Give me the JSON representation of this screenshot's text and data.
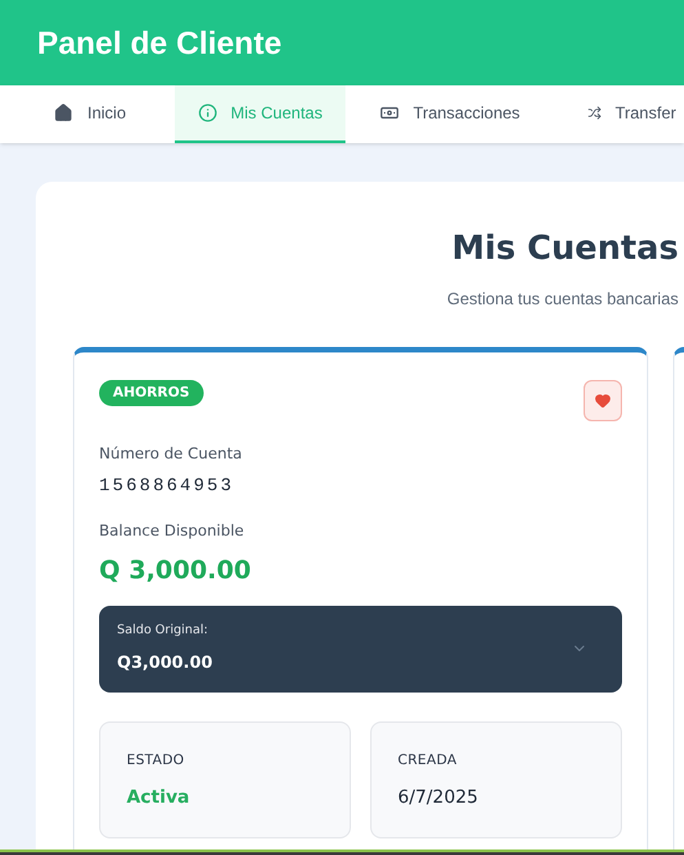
{
  "header": {
    "title": "Panel de Cliente"
  },
  "tabs": [
    {
      "label": "Inicio",
      "selected": false
    },
    {
      "label": "Mis Cuentas",
      "selected": true
    },
    {
      "label": "Transacciones",
      "selected": false
    },
    {
      "label": "Transfer",
      "selected": false
    }
  ],
  "page": {
    "title": "Mis Cuentas",
    "subtitle": "Gestiona tus cuentas bancarias"
  },
  "accounts": [
    {
      "type": "AHORROS",
      "favorite": true,
      "number_label": "Número de Cuenta",
      "number": "1568864953",
      "balance_label": "Balance Disponible",
      "balance": "Q 3,000.00",
      "original_label": "Saldo Original:",
      "original": "Q3,000.00",
      "expanded": false,
      "stats": [
        {
          "label": "ESTADO",
          "value": "Activa",
          "kind": "status"
        },
        {
          "label": "CREADA",
          "value": "6/7/2025",
          "kind": "date"
        }
      ]
    }
  ]
}
